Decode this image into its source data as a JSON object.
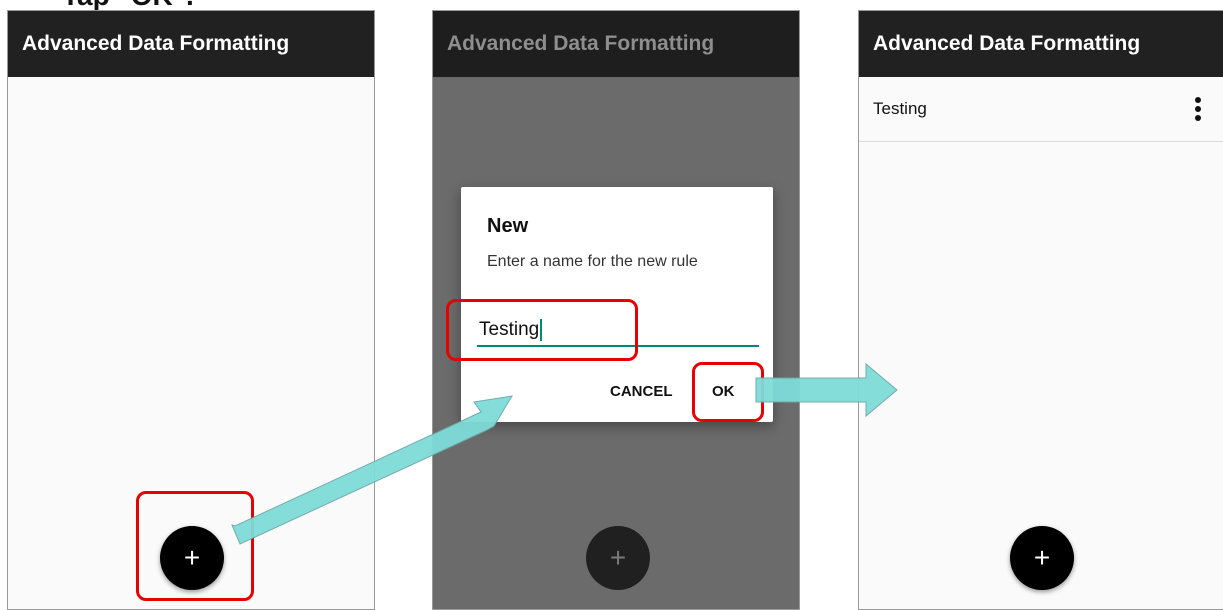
{
  "caption": "Tap \"OK\".",
  "screens": [
    {
      "appbar_title": "Advanced Data Formatting",
      "fab_label": "+"
    },
    {
      "appbar_title": "Advanced Data Formatting",
      "fab_label": "+",
      "dialog": {
        "title": "New",
        "message": "Enter a name for the new rule",
        "input_value": "Testing",
        "cancel_label": "CANCEL",
        "ok_label": "OK"
      }
    },
    {
      "appbar_title": "Advanced Data Formatting",
      "list": [
        {
          "label": "Testing",
          "menu_icon": "kebab-menu-icon"
        }
      ],
      "fab_label": "+"
    }
  ],
  "colors": {
    "appbar": "#212121",
    "accent": "#00897b",
    "highlight": "#e60000",
    "arrow": "#7fdcd9"
  }
}
